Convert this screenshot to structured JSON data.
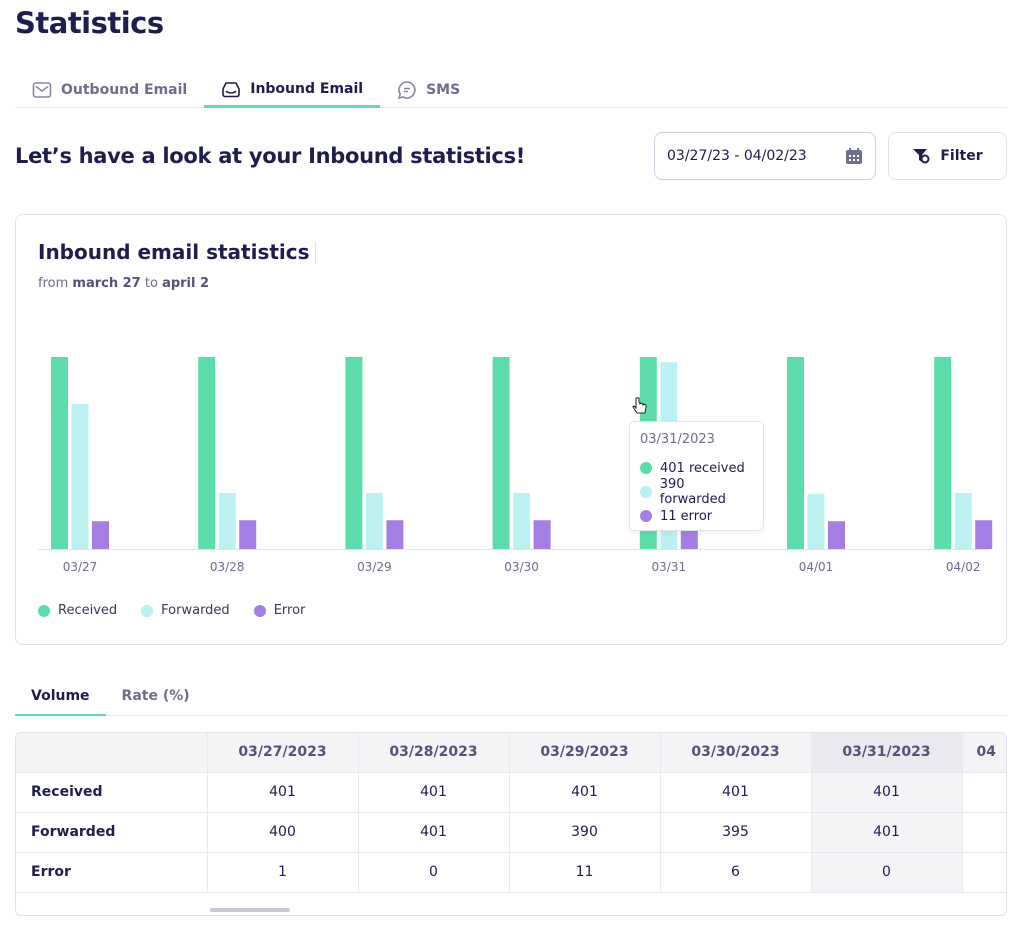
{
  "page": {
    "title": "Statistics",
    "heading": "Let’s have a look at your Inbound statistics!"
  },
  "tabs": [
    {
      "label": "Outbound Email",
      "icon": "envelope-icon"
    },
    {
      "label": "Inbound Email",
      "icon": "inbox-icon",
      "active": true
    },
    {
      "label": "SMS",
      "icon": "chat-bubble-icon"
    }
  ],
  "date_range": {
    "value": "03/27/23 - 04/02/23",
    "icon": "calendar-icon"
  },
  "filter": {
    "label": "Filter",
    "icon": "filter-icon"
  },
  "card": {
    "title": "Inbound email statistics",
    "sub_from": "from",
    "sub_start": "march 27",
    "sub_to": "to",
    "sub_end": "april 2"
  },
  "colors": {
    "received": "#5cdcaa",
    "forwarded": "#bdf0f0",
    "error": "#a57ee3",
    "accent": "#63dca5",
    "text": "#1f1d4d"
  },
  "chart_data": {
    "type": "bar",
    "categories": [
      "03/27",
      "03/28",
      "03/29",
      "03/30",
      "03/31",
      "04/01",
      "04/02"
    ],
    "series": [
      {
        "name": "Received",
        "values": [
          401,
          401,
          401,
          401,
          401,
          401,
          401
        ]
      },
      {
        "name": "Forwarded",
        "values": [
          303,
          117,
          117,
          117,
          390,
          115,
          117
        ]
      },
      {
        "name": "Error",
        "values": [
          58,
          60,
          60,
          60,
          58,
          58,
          60
        ]
      }
    ],
    "ylim": [
      0,
      401
    ],
    "grid": false,
    "legend": "bottom-left",
    "tooltip": {
      "date": "03/31/2023",
      "received": "401 received",
      "forwarded": "390 forwarded",
      "error": "11 error"
    }
  },
  "volume_tabs": [
    {
      "label": "Volume",
      "active": true
    },
    {
      "label": "Rate (%)"
    }
  ],
  "table": {
    "columns": [
      "03/27/2023",
      "03/28/2023",
      "03/29/2023",
      "03/30/2023",
      "03/31/2023",
      "04"
    ],
    "rows": [
      {
        "label": "Received",
        "values": [
          "401",
          "401",
          "401",
          "401",
          "401",
          ""
        ]
      },
      {
        "label": "Forwarded",
        "values": [
          "400",
          "401",
          "390",
          "395",
          "401",
          ""
        ]
      },
      {
        "label": "Error",
        "values": [
          "1",
          "0",
          "11",
          "6",
          "0",
          ""
        ]
      }
    ]
  }
}
